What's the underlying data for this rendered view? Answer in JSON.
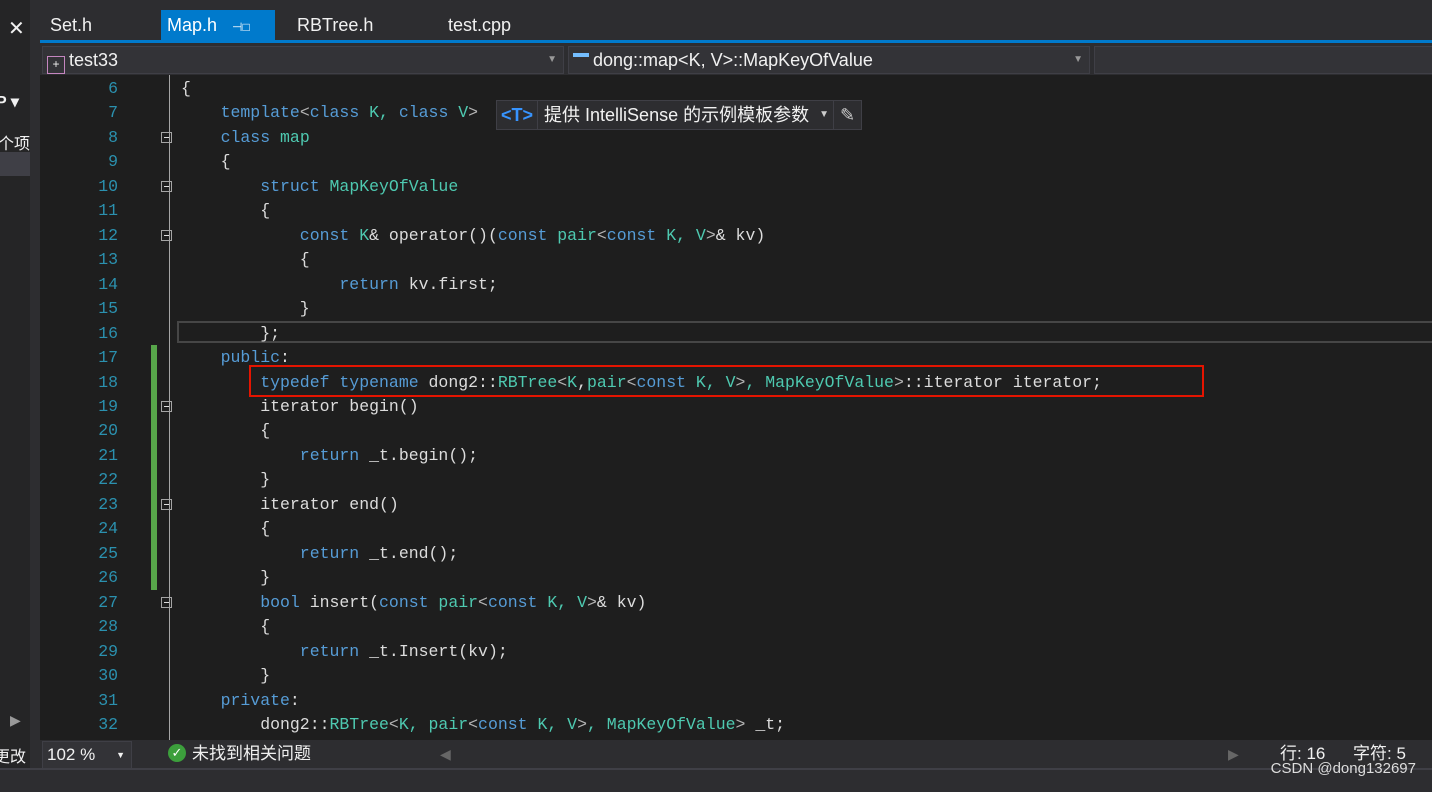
{
  "left_panel": {
    "close": "✕",
    "dropdown": "P ▾",
    "item": "个项",
    "status": "更改"
  },
  "tabs": [
    {
      "label": "Set.h"
    },
    {
      "label": "Map.h",
      "active": true,
      "pin": "⊣□",
      "close": "✕"
    },
    {
      "label": "RBTree.h"
    },
    {
      "label": "test.cpp"
    }
  ],
  "nav": {
    "project": "test33",
    "scope": "dong::map<K, V>::MapKeyOfValue",
    "member": ""
  },
  "hint": {
    "tag": "<T>",
    "label": "提供 IntelliSense 的示例模板参数"
  },
  "lines": [
    {
      "n": "6",
      "ind": 0,
      "t": [
        [
          "{",
          "br"
        ]
      ]
    },
    {
      "n": "7",
      "ind": 1,
      "t": [
        [
          "template",
          "kw"
        ],
        [
          "<",
          "ang"
        ],
        [
          "class",
          "kw"
        ],
        [
          " K, ",
          "ty"
        ],
        [
          "class",
          "kw"
        ],
        [
          " V",
          "ty"
        ],
        [
          ">",
          "ang"
        ]
      ]
    },
    {
      "n": "8",
      "ind": 1,
      "fold": true,
      "t": [
        [
          "class",
          "kw"
        ],
        [
          " map",
          "ty"
        ]
      ]
    },
    {
      "n": "9",
      "ind": 1,
      "t": [
        [
          "{",
          "br"
        ]
      ]
    },
    {
      "n": "10",
      "ind": 2,
      "fold": true,
      "t": [
        [
          "struct",
          "kw"
        ],
        [
          " MapKeyOfValue",
          "ty"
        ]
      ]
    },
    {
      "n": "11",
      "ind": 2,
      "t": [
        [
          "{",
          "br"
        ]
      ]
    },
    {
      "n": "12",
      "ind": 3,
      "fold": true,
      "t": [
        [
          "const",
          "kw"
        ],
        [
          " K",
          "ty"
        ],
        [
          "& operator()(",
          "pl"
        ],
        [
          "const",
          "kw"
        ],
        [
          " pair",
          "ty"
        ],
        [
          "<",
          "ang"
        ],
        [
          "const",
          "kw"
        ],
        [
          " K, V",
          "ty"
        ],
        [
          ">",
          "ang"
        ],
        [
          "& kv)",
          "pl"
        ]
      ]
    },
    {
      "n": "13",
      "ind": 3,
      "t": [
        [
          "{",
          "br"
        ]
      ]
    },
    {
      "n": "14",
      "ind": 4,
      "t": [
        [
          "return",
          "kw"
        ],
        [
          " kv.first;",
          "pl"
        ]
      ]
    },
    {
      "n": "15",
      "ind": 3,
      "t": [
        [
          "}",
          "br"
        ]
      ]
    },
    {
      "n": "16",
      "ind": 2,
      "t": [
        [
          "};",
          "br"
        ]
      ]
    },
    {
      "n": "17",
      "ind": 1,
      "t": [
        [
          "public",
          "kw"
        ],
        [
          ":",
          "pl"
        ]
      ]
    },
    {
      "n": "18",
      "ind": 2,
      "t": [
        [
          "typedef",
          "kw"
        ],
        [
          " ",
          "pl"
        ],
        [
          "typename",
          "kw"
        ],
        [
          " dong2::",
          "pl"
        ],
        [
          "RBTree",
          "ty"
        ],
        [
          "<",
          "ang"
        ],
        [
          "K",
          "ty"
        ],
        [
          ",",
          "pl"
        ],
        [
          "pair",
          "ty"
        ],
        [
          "<",
          "ang"
        ],
        [
          "const",
          "kw"
        ],
        [
          " K, V",
          "ty"
        ],
        [
          ">",
          "ang"
        ],
        [
          ", MapKeyOfValue",
          "ty"
        ],
        [
          ">",
          "ang"
        ],
        [
          "::iterator iterator;",
          "pl"
        ]
      ]
    },
    {
      "n": "19",
      "ind": 2,
      "fold": true,
      "t": [
        [
          "iterator begin()",
          "pl"
        ]
      ]
    },
    {
      "n": "20",
      "ind": 2,
      "t": [
        [
          "{",
          "br"
        ]
      ]
    },
    {
      "n": "21",
      "ind": 3,
      "t": [
        [
          "return",
          "kw"
        ],
        [
          " _t.begin();",
          "pl"
        ]
      ]
    },
    {
      "n": "22",
      "ind": 2,
      "t": [
        [
          "}",
          "br"
        ]
      ]
    },
    {
      "n": "23",
      "ind": 2,
      "fold": true,
      "t": [
        [
          "iterator end()",
          "pl"
        ]
      ]
    },
    {
      "n": "24",
      "ind": 2,
      "t": [
        [
          "{",
          "br"
        ]
      ]
    },
    {
      "n": "25",
      "ind": 3,
      "t": [
        [
          "return",
          "kw"
        ],
        [
          " _t.end();",
          "pl"
        ]
      ]
    },
    {
      "n": "26",
      "ind": 2,
      "t": [
        [
          "}",
          "br"
        ]
      ]
    },
    {
      "n": "27",
      "ind": 2,
      "fold": true,
      "t": [
        [
          "bool",
          "kw"
        ],
        [
          " insert(",
          "pl"
        ],
        [
          "const",
          "kw"
        ],
        [
          " pair",
          "ty"
        ],
        [
          "<",
          "ang"
        ],
        [
          "const",
          "kw"
        ],
        [
          " K, V",
          "ty"
        ],
        [
          ">",
          "ang"
        ],
        [
          "& kv)",
          "pl"
        ]
      ]
    },
    {
      "n": "28",
      "ind": 2,
      "t": [
        [
          "{",
          "br"
        ]
      ]
    },
    {
      "n": "29",
      "ind": 3,
      "t": [
        [
          "return",
          "kw"
        ],
        [
          " _t.Insert(kv);",
          "pl"
        ]
      ]
    },
    {
      "n": "30",
      "ind": 2,
      "t": [
        [
          "}",
          "br"
        ]
      ]
    },
    {
      "n": "31",
      "ind": 1,
      "t": [
        [
          "private",
          "kw"
        ],
        [
          ":",
          "pl"
        ]
      ]
    },
    {
      "n": "32",
      "ind": 2,
      "t": [
        [
          "dong2::",
          "pl"
        ],
        [
          "RBTree",
          "ty"
        ],
        [
          "<",
          "ang"
        ],
        [
          "K, pair",
          "ty"
        ],
        [
          "<",
          "ang"
        ],
        [
          "const",
          "kw"
        ],
        [
          " K, V",
          "ty"
        ],
        [
          ">",
          "ang"
        ],
        [
          ", MapKeyOfValue",
          "ty"
        ],
        [
          ">",
          "ang"
        ],
        [
          " _t;",
          "pl"
        ]
      ]
    }
  ],
  "status": {
    "zoom": "102 %",
    "issues": "未找到相关问题",
    "line": "行: 16",
    "char": "字符: 5"
  },
  "watermark": "CSDN @dong132697",
  "colors": {
    "accent": "#007acc",
    "highlight_box": "#e51400",
    "change_bar": "#57a64a"
  }
}
